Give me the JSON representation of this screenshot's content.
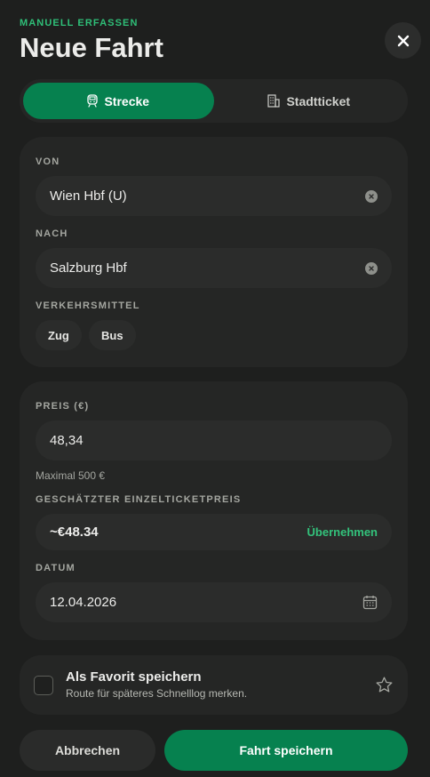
{
  "header": {
    "overline": "MANUELL ERFASSEN",
    "title": "Neue Fahrt",
    "close_icon": "close-icon"
  },
  "mode_tabs": [
    {
      "label": "Strecke",
      "icon": "train-icon",
      "active": true
    },
    {
      "label": "Stadtticket",
      "icon": "building-icon",
      "active": false
    }
  ],
  "route": {
    "from_label": "VON",
    "from_value": "Wien Hbf (U)",
    "to_label": "NACH",
    "to_value": "Salzburg Hbf",
    "transport_label": "VERKEHRSMITTEL",
    "transport_options": [
      "Zug",
      "Bus"
    ]
  },
  "details": {
    "price_label": "PREIS (€)",
    "price_value": "48,34",
    "price_hint": "Maximal 500 €",
    "estimate_label": "GESCHÄTZTER EINZELTICKETPREIS",
    "estimate_value": "~€48.34",
    "estimate_action": "Übernehmen",
    "date_label": "DATUM",
    "date_value": "12.04.2026"
  },
  "favorite": {
    "title": "Als Favorit speichern",
    "subtitle": "Route für späteres Schnelllog merken.",
    "checked": false
  },
  "actions": {
    "cancel": "Abbrechen",
    "save": "Fahrt speichern"
  },
  "colors": {
    "accent": "#06814f",
    "accent_text": "#33c27b",
    "background": "#1e1f1e",
    "card": "#252625"
  }
}
